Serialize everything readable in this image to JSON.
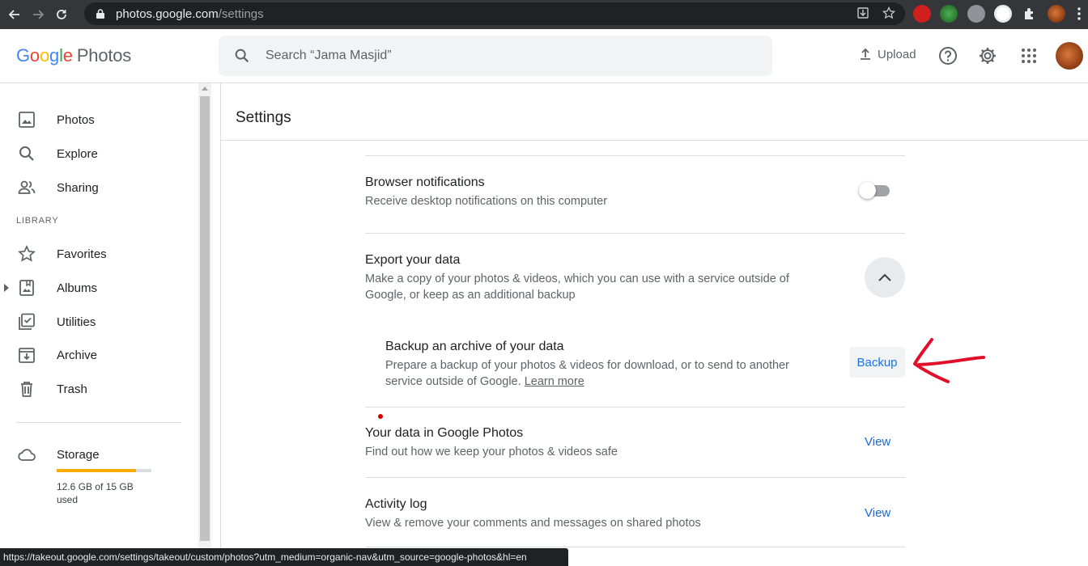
{
  "browser": {
    "url_host": "photos.google.com",
    "url_path": "/settings",
    "status_url": "https://takeout.google.com/settings/takeout/custom/photos?utm_medium=organic-nav&utm_source=google-photos&hl=en"
  },
  "header": {
    "logo_google": [
      "G",
      "o",
      "o",
      "g",
      "l",
      "e"
    ],
    "logo_product": "Photos",
    "search_placeholder": "Search “Jama Masjid”",
    "upload_label": "Upload"
  },
  "sidebar": {
    "items": [
      {
        "label": "Photos",
        "icon": "photo-icon"
      },
      {
        "label": "Explore",
        "icon": "search-icon"
      },
      {
        "label": "Sharing",
        "icon": "people-icon"
      }
    ],
    "library_heading": "LIBRARY",
    "library_items": [
      {
        "label": "Favorites",
        "icon": "star-icon"
      },
      {
        "label": "Albums",
        "icon": "album-icon"
      },
      {
        "label": "Utilities",
        "icon": "utilities-icon"
      },
      {
        "label": "Archive",
        "icon": "archive-icon"
      },
      {
        "label": "Trash",
        "icon": "trash-icon"
      }
    ],
    "storage": {
      "label": "Storage",
      "used_text": "12.6 GB of 15 GB used",
      "used_fraction": 0.84
    }
  },
  "main": {
    "page_title": "Settings",
    "rows": {
      "notifications": {
        "title": "Browser notifications",
        "desc": "Receive desktop notifications on this computer",
        "enabled": false
      },
      "export": {
        "title": "Export your data",
        "desc": "Make a copy of your photos & videos, which you can use with a service outside of Google, or keep as an additional backup"
      },
      "backup": {
        "title": "Backup an archive of your data",
        "desc": "Prepare a backup of your photos & videos for download, or to send to another service outside of Google.",
        "learn_more": "Learn more",
        "button": "Backup"
      },
      "your_data": {
        "title": "Your data in Google Photos",
        "desc": "Find out how we keep your photos & videos safe",
        "link": "View"
      },
      "activity": {
        "title": "Activity log",
        "desc": "View & remove your comments and messages on shared photos",
        "link": "View"
      }
    }
  },
  "colors": {
    "accent": "#1a73e8",
    "annotation": "#e0102a",
    "storage_bar": "#f9ab00"
  }
}
